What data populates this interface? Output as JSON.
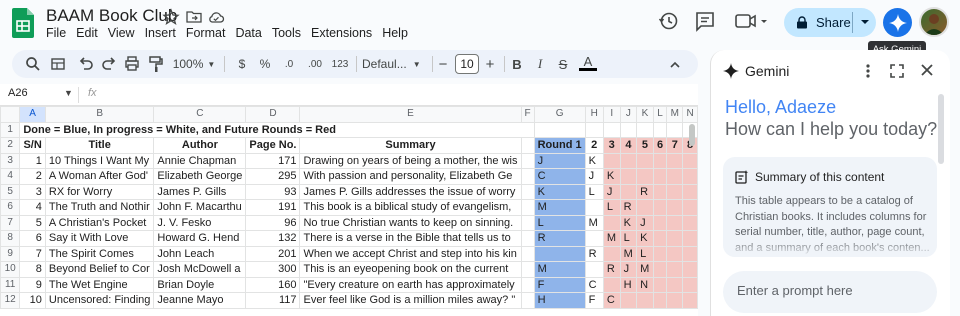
{
  "header": {
    "doc_title": "BAAM Book Club",
    "menu": [
      "File",
      "Edit",
      "View",
      "Insert",
      "Format",
      "Data",
      "Tools",
      "Extensions",
      "Help"
    ],
    "share_label": "Share",
    "tooltip": "Ask Gemini"
  },
  "toolbar": {
    "zoom": "100%",
    "currency": "$",
    "percent": "%",
    "dec_decrease": ".0",
    "dec_increase": ".00",
    "number_format": "123",
    "font": "Defaul...",
    "font_size": "10",
    "minus": "−",
    "plus": "+",
    "bold": "B",
    "italic": "I",
    "strike": "S",
    "text_color": "A"
  },
  "formula_bar": {
    "namebox": "A26",
    "fx": "fx"
  },
  "sheet": {
    "col_headers": [
      "A",
      "B",
      "C",
      "D",
      "E",
      "F",
      "G",
      "H",
      "I",
      "J",
      "K",
      "L",
      "M",
      "N"
    ],
    "row1": "Done = Blue, In progress = White, and Future Rounds = Red",
    "header_row": [
      "S/N",
      "Title",
      "Author",
      "Page No.",
      "Summary",
      "",
      "Round 1",
      "2",
      "3",
      "4",
      "5",
      "6",
      "7",
      "8"
    ],
    "rows": [
      {
        "n": "3",
        "cells": [
          "1",
          "10 Things I Want My",
          "Annie Chapman",
          "171",
          "Drawing on years of being a mother, the wis",
          "",
          "J",
          "K",
          "",
          "",
          "",
          "",
          "",
          ""
        ]
      },
      {
        "n": "4",
        "cells": [
          "2",
          "A Woman After God'",
          "Elizabeth George",
          "295",
          "With passion and personality, Elizabeth Ge",
          "",
          "C",
          "J",
          "K",
          "",
          "",
          "",
          "",
          ""
        ]
      },
      {
        "n": "5",
        "cells": [
          "3",
          "RX for Worry",
          "James P. Gills",
          "93",
          "James P. Gills addresses the issue of worry",
          "",
          "K",
          "L",
          "J",
          "",
          "R",
          "",
          "",
          ""
        ]
      },
      {
        "n": "6",
        "cells": [
          "4",
          "The Truth and Nothir",
          "John F. Macarthu",
          "191",
          "This book is a biblical study of evangelism,",
          "",
          "M",
          "",
          "L",
          "R",
          "",
          "",
          "",
          ""
        ]
      },
      {
        "n": "7",
        "cells": [
          "5",
          "A Christian's Pocket",
          "J. V. Fesko",
          "96",
          "No true Christian wants to keep on sinning.",
          "",
          "L",
          "M",
          "",
          "K",
          "J",
          "",
          "",
          ""
        ]
      },
      {
        "n": "8",
        "cells": [
          "6",
          "Say it With Love",
          "Howard G. Hend",
          "132",
          "There is a verse in the Bible that tells us to",
          "",
          "R",
          "",
          "M",
          "L",
          "K",
          "",
          "",
          ""
        ]
      },
      {
        "n": "9",
        "cells": [
          "7",
          "The Spirit Comes",
          "John Leach",
          "201",
          "When we accept Christ and step into his kin",
          "",
          "",
          "R",
          "",
          "M",
          "L",
          "",
          "",
          ""
        ]
      },
      {
        "n": "10",
        "cells": [
          "8",
          "Beyond Belief to Cor",
          "Josh McDowell a",
          "300",
          "This is an eyeopening book on the current",
          "",
          "M",
          "",
          "R",
          "J",
          "M",
          "",
          "",
          ""
        ]
      },
      {
        "n": "11",
        "cells": [
          "9",
          "The Wet Engine",
          "Brian Doyle",
          "160",
          "\"Every creature on earth has approximately",
          "",
          "F",
          "C",
          "",
          "H",
          "N",
          "",
          "",
          ""
        ]
      },
      {
        "n": "12",
        "cells": [
          "10",
          "Uncensored: Finding",
          "Jeanne Mayo",
          "117",
          "Ever feel like God is a million miles away? \"",
          "",
          "H",
          "F",
          "C",
          "",
          "",
          "",
          "",
          ""
        ]
      }
    ]
  },
  "gemini": {
    "title": "Gemini",
    "greeting": "Hello, Adaeze",
    "question": "How can I help you today?",
    "summary_title": "Summary of this content",
    "summary_text": "This table appears to be a catalog of Christian books. It includes columns for serial number, title, author, page count, and a summary of each book's conten...",
    "prompt_placeholder": "Enter a prompt here"
  },
  "colors": {
    "done": "#8fb4ea",
    "future": "#f4c7c3",
    "share_bg": "#c2e7ff",
    "gemini_blue": "#4285f4"
  }
}
